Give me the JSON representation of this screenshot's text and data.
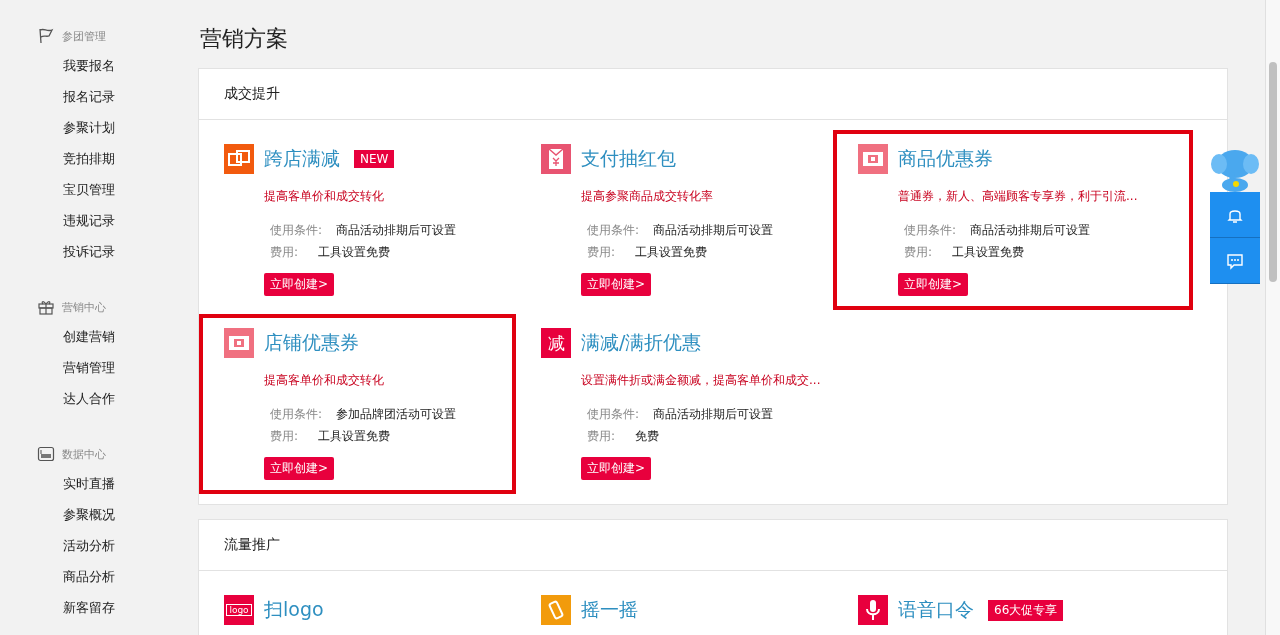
{
  "sidebar": {
    "groups": [
      {
        "title": "参团管理",
        "items": [
          "我要报名",
          "报名记录",
          "参聚计划",
          "竞拍排期",
          "宝贝管理",
          "违规记录",
          "投诉记录"
        ]
      },
      {
        "title": "营销中心",
        "items": [
          "创建营销",
          "营销管理",
          "达人合作"
        ]
      },
      {
        "title": "数据中心",
        "items": [
          "实时直播",
          "参聚概况",
          "活动分析",
          "商品分析",
          "新客留存"
        ]
      }
    ]
  },
  "page_title": "营销方案",
  "sections": [
    {
      "title": "成交提升",
      "cards": [
        {
          "title": "跨店满减",
          "tag": "NEW",
          "description": "提高客单价和成交转化",
          "condition_label": "使用条件:",
          "condition": "商品活动排期后可设置",
          "fee_label": "费用:",
          "fee": "工具设置免费",
          "button": "立即创建>",
          "highlighted": false
        },
        {
          "title": "支付抽红包",
          "description": "提高参聚商品成交转化率",
          "condition_label": "使用条件:",
          "condition": "商品活动排期后可设置",
          "fee_label": "费用:",
          "fee": "工具设置免费",
          "button": "立即创建>",
          "highlighted": false
        },
        {
          "title": "商品优惠券",
          "description": "普通券，新人、高端顾客专享券，利于引流...",
          "condition_label": "使用条件:",
          "condition": "商品活动排期后可设置",
          "fee_label": "费用:",
          "fee": "工具设置免费",
          "button": "立即创建>",
          "highlighted": true
        },
        {
          "title": "店铺优惠券",
          "description": "提高客单价和成交转化",
          "condition_label": "使用条件:",
          "condition": "参加品牌团活动可设置",
          "fee_label": "费用:",
          "fee": "工具设置免费",
          "button": "立即创建>",
          "highlighted": true
        },
        {
          "title": "满减/满折优惠",
          "icon_text": "减",
          "description": "设置满件折或满金额减，提高客单价和成交...",
          "condition_label": "使用条件:",
          "condition": "商品活动排期后可设置",
          "fee_label": "费用:",
          "fee": "免费",
          "button": "立即创建>",
          "highlighted": false
        }
      ]
    },
    {
      "title": "流量推广",
      "cards": [
        {
          "title": "扫logo",
          "icon_text": "logo"
        },
        {
          "title": "摇一摇"
        },
        {
          "title": "语音口令",
          "tag": "66大促专享"
        }
      ]
    }
  ]
}
